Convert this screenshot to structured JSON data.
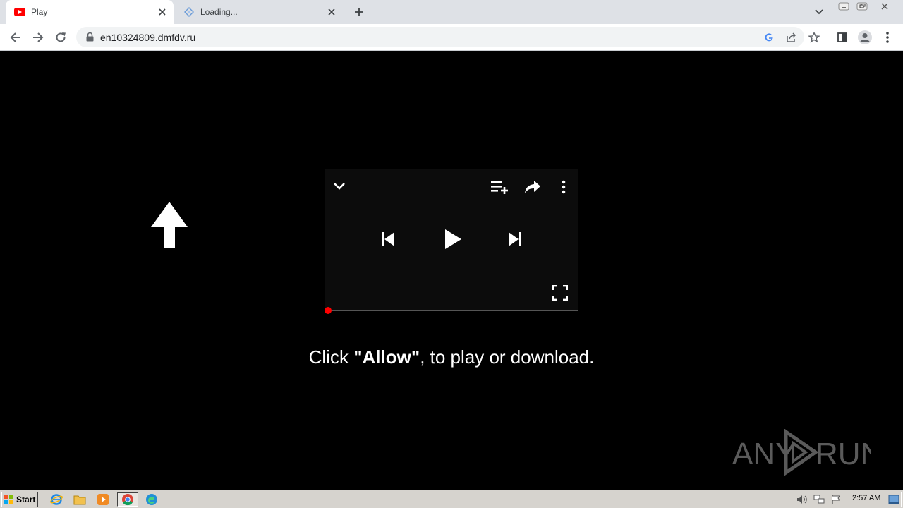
{
  "tabs": [
    {
      "title": "Play",
      "icon": "youtube-icon"
    },
    {
      "title": "Loading...",
      "icon": "loading-icon"
    }
  ],
  "address_bar": {
    "url": "en10324809.dmfdv.ru"
  },
  "page": {
    "caption_prefix": "Click ",
    "caption_bold": "\"Allow\"",
    "caption_suffix": ", to play or download.",
    "watermark_left": "ANY",
    "watermark_right": "RUN"
  },
  "taskbar": {
    "start_label": "Start",
    "clock": "2:57 AM"
  },
  "colors": {
    "progress_dot": "#ff0000",
    "youtube_red": "#ff0000",
    "page_background": "#000000"
  }
}
